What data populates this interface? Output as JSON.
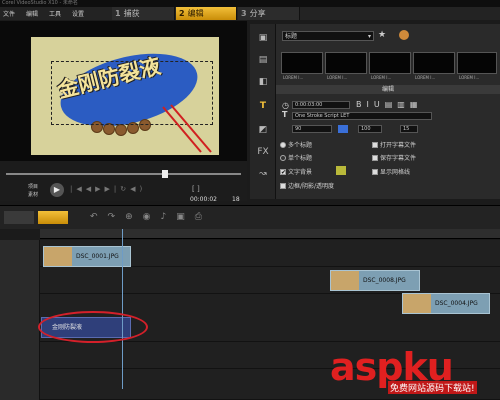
{
  "titlebar": {
    "text": "Corel VideoStudio X10 - 未命名"
  },
  "menu": {
    "items": [
      "文件",
      "编辑",
      "工具",
      "设置"
    ]
  },
  "steps": [
    {
      "num": "1",
      "label": "捕获"
    },
    {
      "num": "2",
      "label": "编辑"
    },
    {
      "num": "3",
      "label": "分享"
    }
  ],
  "preview": {
    "overlay_text": "金刚防裂液",
    "project_label": "项目",
    "clip_label": "素材",
    "timecode": "00:00:02",
    "frame": "18"
  },
  "library": {
    "category": "标题",
    "thumbs": [
      "LOREM I...",
      "LOREM I...",
      "LOREM I...",
      "LOREM I...",
      "LOREM I..."
    ]
  },
  "edit_panel": {
    "header": "编辑",
    "duration": "0:00:03:00",
    "font": "One Stroke Script LET",
    "size": "90",
    "line_spacing": "100",
    "angle": "15",
    "multi_title": "多个标题",
    "single_title": "单个标题",
    "open_subtitle": "打开字幕文件",
    "save_subtitle": "保存字幕文件",
    "text_bg": "文字背景",
    "show_grid": "显示网格线",
    "border_label": "边框/阴影/透明度"
  },
  "timeline": {
    "clips": [
      "DSC_0001.JPG",
      "DSC_0008.JPG",
      "DSC_0004.JPG"
    ],
    "title_clip": "金刚防裂液"
  },
  "watermark": {
    "logo": "aspku",
    "sub": "免费网站源码下载站!"
  }
}
